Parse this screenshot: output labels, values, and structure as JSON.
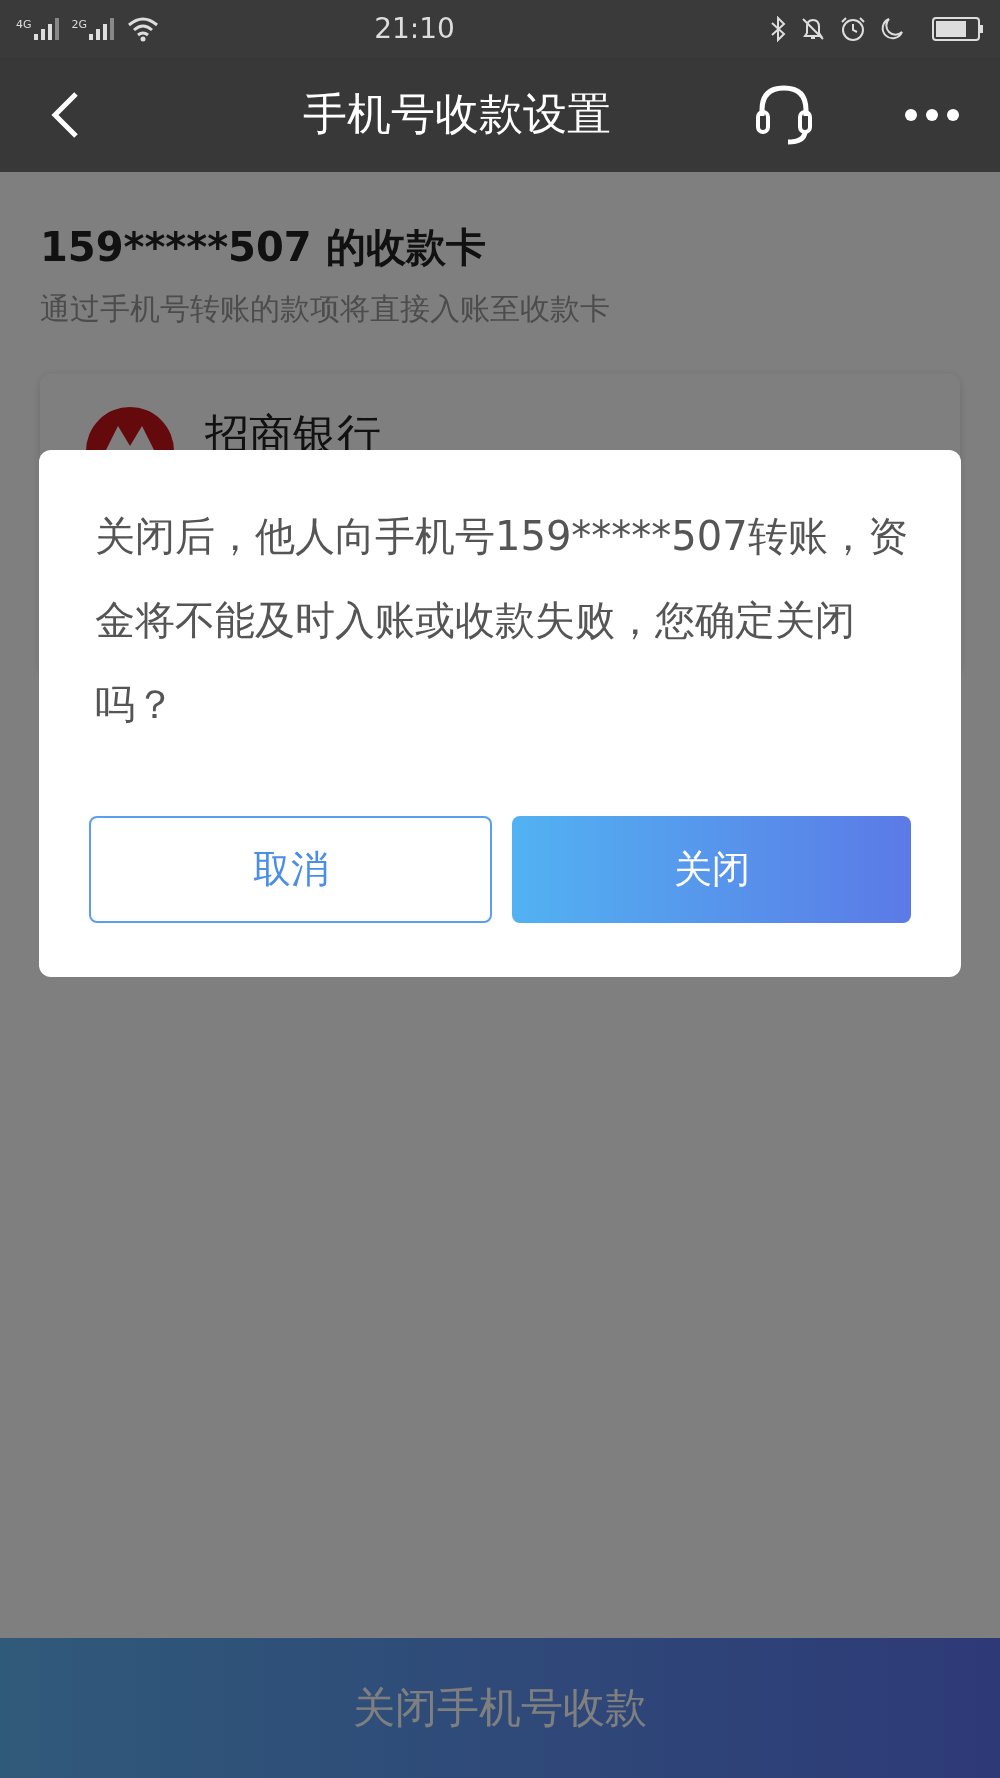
{
  "status_bar": {
    "signal_1": "4G",
    "signal_2": "2G",
    "time": "21:10"
  },
  "header": {
    "title": "手机号收款设置"
  },
  "section": {
    "title": "159*****507 的收款卡",
    "subtitle": "通过手机号转账的款项将直接入账至收款卡"
  },
  "card": {
    "bank_name": "招商银行"
  },
  "dialog": {
    "message": "关闭后，他人向手机号159*****507转账，资金将不能及时入账或收款失败，您确定关闭吗？",
    "buttons": [
      {
        "label": "取消",
        "kind": "secondary"
      },
      {
        "label": "关闭",
        "kind": "primary"
      }
    ]
  },
  "bottom_button": {
    "label": "关闭手机号收款"
  }
}
